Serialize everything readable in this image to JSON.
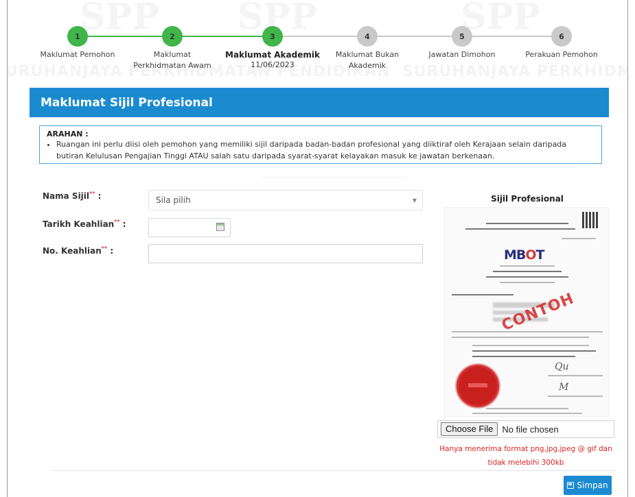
{
  "stepper": {
    "steps": [
      {
        "number": "1",
        "label": "Maklumat Pemohon",
        "state": "done"
      },
      {
        "number": "2",
        "label": "Maklumat Perkhidmatan Awam",
        "state": "done"
      },
      {
        "number": "3",
        "label": "Maklumat Akademik",
        "date": "11/06/2023",
        "state": "active"
      },
      {
        "number": "4",
        "label": "Maklumat Bukan Akademik",
        "state": "pending"
      },
      {
        "number": "5",
        "label": "Jawatan Dimohon",
        "state": "pending"
      },
      {
        "number": "6",
        "label": "Perakuan Pemohon",
        "state": "pending"
      }
    ],
    "colors": {
      "done": "#3fb54a",
      "pending": "#c9c9c9"
    }
  },
  "watermark": {
    "band_text": "SURUHANJAYA PERKHIDMATAN PENDIDIKAN",
    "logo_text": "SPP"
  },
  "section": {
    "title": "Maklumat Sijil Profesional"
  },
  "note": {
    "title": "ARAHAN :",
    "text": "Ruangan ini perlu diisi oleh pemohon yang memiliki sijil daripada badan-badan profesional yang diiktiraf oleh Kerajaan selain daripada butiran Kelulusan Pengajian Tinggi ATAU salah satu daripada syarat-syarat kelayakan masuk ke jawatan berkenaan."
  },
  "form": {
    "cert_name_label": "Nama Sijil",
    "cert_name_value": "Sila pilih",
    "expertise_date_label": "Tarikh Keahlian",
    "membership_no_label": "No. Keahlian",
    "required_mark": "**",
    "colon": ":"
  },
  "preview": {
    "title": "Sijil Profesional",
    "logo": "MBOT",
    "stamp": "CONTOH"
  },
  "upload": {
    "button": "Choose File",
    "status": "No file chosen",
    "hint": "Hanya menerima format png,jpg,jpeg @ gif dan tidak melebihi 300kb"
  },
  "actions": {
    "save": "Simpan"
  },
  "colors": {
    "accent": "#1b8bd0",
    "required": "#e04040"
  }
}
